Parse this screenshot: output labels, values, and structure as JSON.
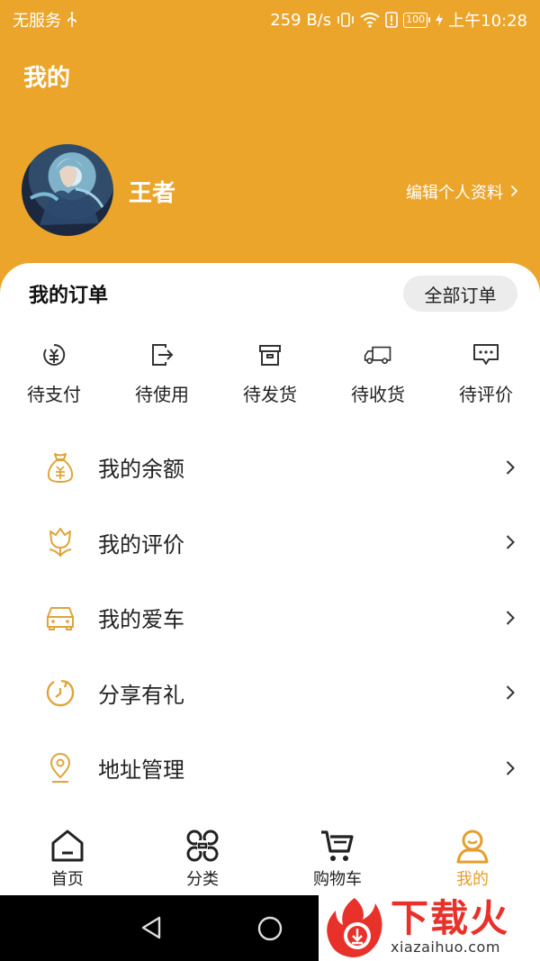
{
  "status_bar": {
    "carrier": "无服务",
    "net_speed": "259 B/s",
    "battery": "100",
    "time": "上午10:28"
  },
  "header": {
    "title": "我的",
    "user_name": "王者",
    "edit_profile": "编辑个人资料"
  },
  "orders": {
    "title": "我的订单",
    "all_orders": "全部订单",
    "items": [
      {
        "label": "待支付",
        "icon": "yuan-circle-icon"
      },
      {
        "label": "待使用",
        "icon": "exit-box-icon"
      },
      {
        "label": "待发货",
        "icon": "box-icon"
      },
      {
        "label": "待收货",
        "icon": "truck-icon"
      },
      {
        "label": "待评价",
        "icon": "chat-bubble-icon"
      }
    ]
  },
  "menu": [
    {
      "label": "我的余额",
      "icon": "money-bag-icon"
    },
    {
      "label": "我的评价",
      "icon": "tulip-icon"
    },
    {
      "label": "我的爱车",
      "icon": "car-icon"
    },
    {
      "label": "分享有礼",
      "icon": "refresh-icon"
    },
    {
      "label": "地址管理",
      "icon": "location-pin-icon"
    }
  ],
  "tabs": [
    {
      "label": "首页",
      "icon": "home-icon",
      "active": false
    },
    {
      "label": "分类",
      "icon": "category-icon",
      "active": false
    },
    {
      "label": "购物车",
      "icon": "cart-icon",
      "active": false
    },
    {
      "label": "我的",
      "icon": "user-icon",
      "active": true
    }
  ],
  "watermark": {
    "cn": "下载火",
    "en": "xiazaihuo.com"
  },
  "colors": {
    "accent": "#EBA52A",
    "icon_gold": "#E0A43A",
    "tab_active": "#E59E2B",
    "watermark_red": "#E8312A"
  }
}
